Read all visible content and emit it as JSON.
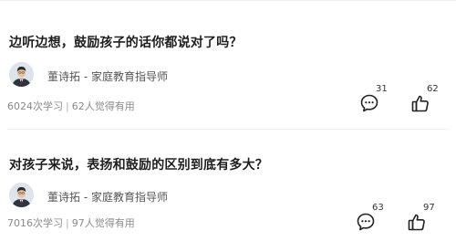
{
  "posts": [
    {
      "title": "边听边想，鼓励孩子的话你都说对了吗？",
      "author": "董诗拓 - 家庭教育指导师",
      "learners": "6024次学习",
      "helpful": "62人觉得有用",
      "comment_count": "31",
      "like_count": "62"
    },
    {
      "title": "对孩子来说，表扬和鼓励的区别到底有多大？",
      "author": "董诗拓 - 家庭教育指导师",
      "learners": "7016次学习",
      "helpful": "97人觉得有用",
      "comment_count": "63",
      "like_count": "97"
    }
  ],
  "icons": {
    "comment": "comment-bubble-icon",
    "like": "thumbs-up-icon"
  },
  "colors": {
    "title": "#1e1e1e",
    "meta": "#8a8a8a",
    "author": "#555555",
    "divider": "#eeeeee"
  }
}
